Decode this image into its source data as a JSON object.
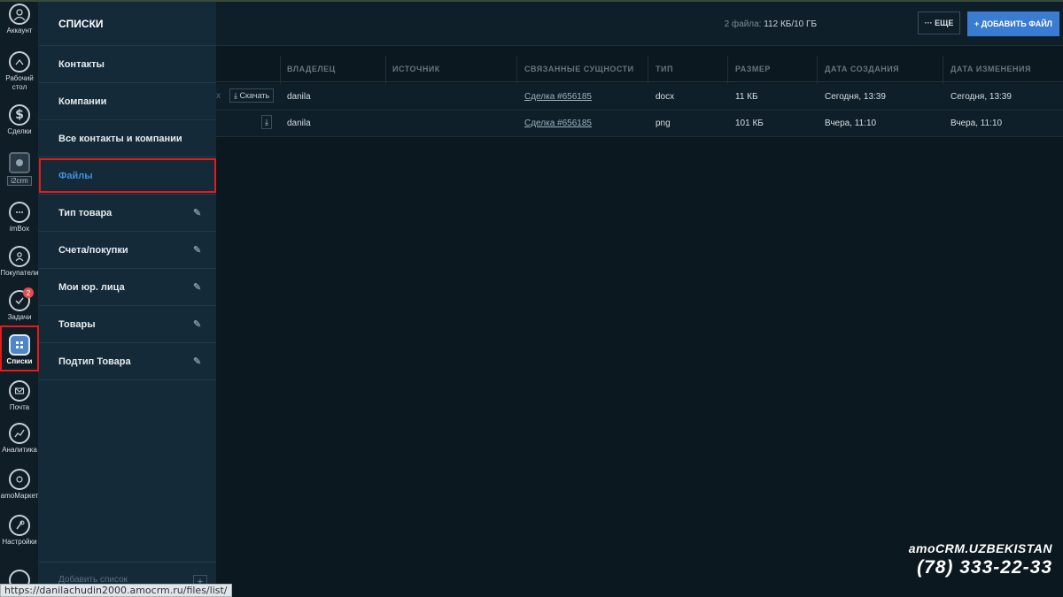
{
  "rail": {
    "items": [
      {
        "label": "Аккаунт",
        "icon": "user-icon"
      },
      {
        "label": "Рабочий стол",
        "icon": "dashboard-icon"
      },
      {
        "label": "Сделки",
        "icon": "dollar-icon"
      },
      {
        "label": "i2crm",
        "icon": "i2crm-icon"
      },
      {
        "label": "imBox",
        "icon": "chat-icon"
      },
      {
        "label": "Покупатели",
        "icon": "customers-icon"
      },
      {
        "label": "Задачи",
        "icon": "check-icon",
        "badge": "2"
      },
      {
        "label": "Списки",
        "icon": "lists-icon"
      },
      {
        "label": "Почта",
        "icon": "mail-icon"
      },
      {
        "label": "Аналитика",
        "icon": "analytics-icon"
      },
      {
        "label": "amoМаркет",
        "icon": "market-icon"
      },
      {
        "label": "Настройки",
        "icon": "settings-icon"
      }
    ]
  },
  "panel": {
    "title": "СПИСКИ",
    "items": [
      {
        "label": "Контакты"
      },
      {
        "label": "Компании"
      },
      {
        "label": "Все контакты и компании"
      },
      {
        "label": "Файлы"
      },
      {
        "label": "Тип товара"
      },
      {
        "label": "Счета/покупки"
      },
      {
        "label": "Мои юр. лица"
      },
      {
        "label": "Товары"
      },
      {
        "label": "Подтип Товара"
      }
    ],
    "footer": "Добавить список"
  },
  "header": {
    "quota_prefix": "2 файла:",
    "quota_value": "112 КБ/10 ГБ",
    "more_label": "ЕЩЕ",
    "add_label": "ДОБАВИТЬ ФАЙЛ"
  },
  "table": {
    "columns": [
      "ВЛАДЕЛЕЦ",
      "ИСТОЧНИК",
      "СВЯЗАННЫЕ СУЩНОСТИ",
      "ТИП",
      "РАЗМЕР",
      "ДАТА СОЗДАНИЯ",
      "ДАТА ИЗМЕНЕНИЯ"
    ],
    "rows": [
      {
        "name_tail": "x",
        "download": "Скачать",
        "owner": "danila",
        "source": "",
        "entity": "Сделка #656185",
        "type": "docx",
        "size": "11 КБ",
        "created": "Сегодня, 13:39",
        "modified": "Сегодня, 13:39"
      },
      {
        "name_tail": "",
        "download": "",
        "owner": "danila",
        "source": "",
        "entity": "Сделка #656185",
        "type": "png",
        "size": "101 КБ",
        "created": "Вчера, 11:10",
        "modified": "Вчера, 11:10"
      }
    ]
  },
  "watermark": {
    "line1": "amoCRM.UZBEKISTAN",
    "line2": "(78) 333-22-33"
  },
  "status_url": "https://danilachudin2000.amocrm.ru/files/list/",
  "colors": {
    "accent": "#3a7cd1",
    "highlight": "#e21b1b",
    "panel_bg": "#142a38",
    "page_bg": "#0c1820"
  }
}
